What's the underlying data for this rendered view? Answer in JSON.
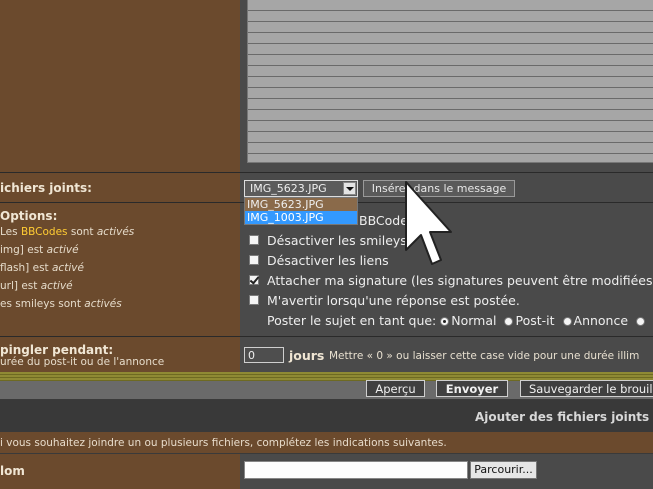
{
  "attachments": {
    "label": "ichiers joints:",
    "selected": "IMG_5623.JPG",
    "options": [
      "IMG_5623.JPG",
      "IMG_1003.JPG"
    ],
    "insert_button": "Insérer dans le message"
  },
  "options_section": {
    "label": "Options:",
    "bbcode_line": {
      "prefix": "Les ",
      "link": "BBCodes",
      "middle": " sont ",
      "status": "activés"
    },
    "img_line": {
      "prefix": "img] est ",
      "status": "activé"
    },
    "flash_line": {
      "prefix": "flash] est ",
      "status": "activé"
    },
    "url_line": {
      "prefix": "url] est ",
      "status": "activé"
    },
    "smileys_line": {
      "prefix": "es smileys sont ",
      "status": "activés"
    },
    "disable_bbcode_partial": "BBCode",
    "disable_smileys": "Désactiver les smileys",
    "disable_links": "Désactiver les liens",
    "attach_signature": "Attacher ma signature (les signatures peuvent être modifiées",
    "notify_reply": "M'avertir lorsqu'une réponse est postée.",
    "post_as_label": "Poster le sujet en tant que:",
    "post_types": [
      "Normal",
      "Post-it",
      "Annonce"
    ]
  },
  "pin": {
    "label": "pingler pendant:",
    "sublabel": "urée du post-it ou de l'annonce",
    "value": "0",
    "unit": "jours",
    "hint": "Mettre « 0 » ou laisser cette case vide pour une durée illim"
  },
  "actions": {
    "preview": "Aperçu",
    "send": "Envoyer",
    "save_draft": "Sauvegarder le brouil"
  },
  "upload": {
    "header": "Ajouter des fichiers joints",
    "intro": "i vous souhaitez joindre un ou plusieurs fichiers, complétez les indications suivantes.",
    "name_label": "lom",
    "browse": "Parcourir..."
  }
}
